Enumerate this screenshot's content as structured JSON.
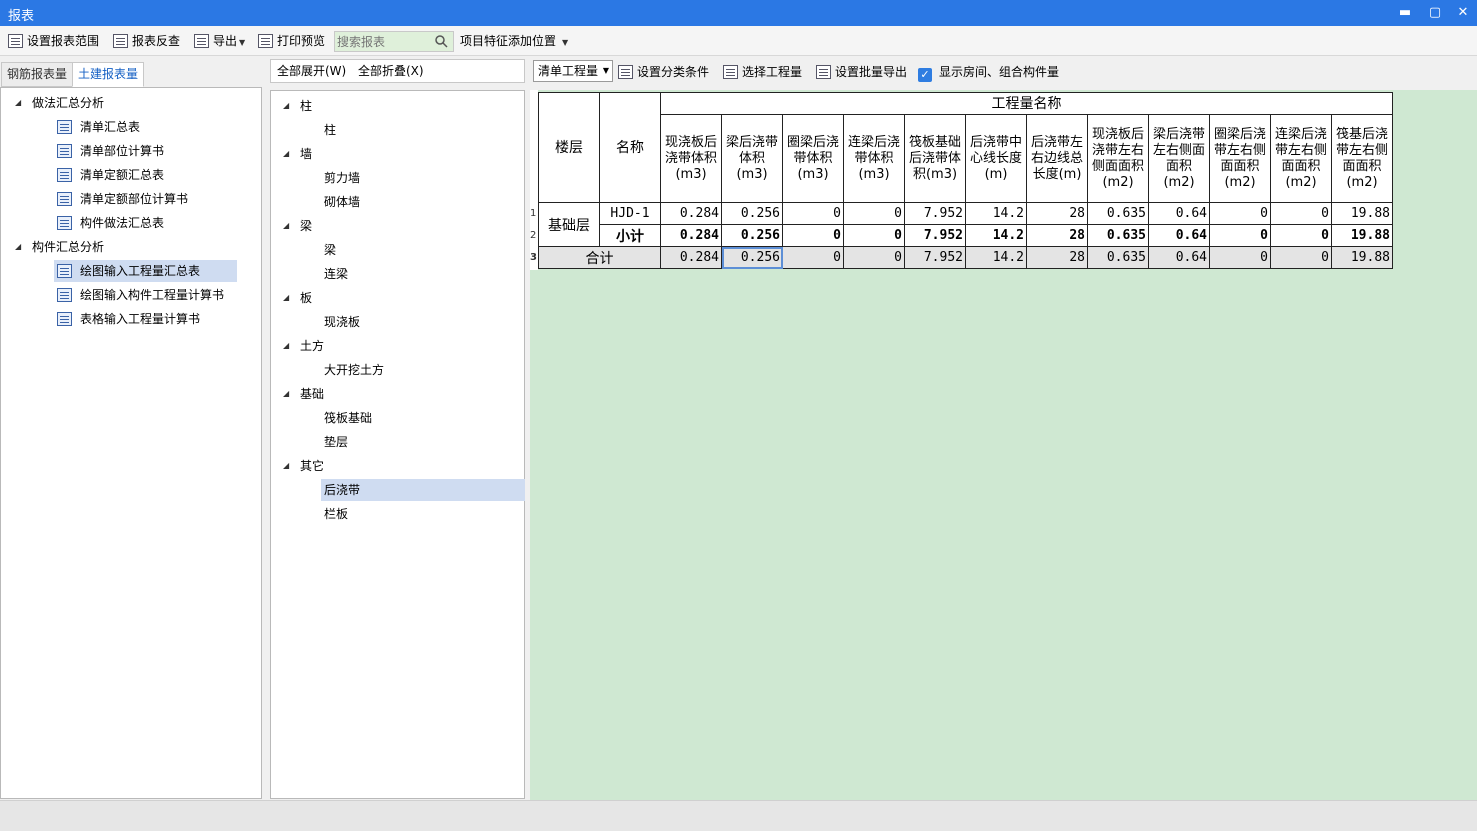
{
  "window": {
    "title": "报表",
    "min": "▬",
    "max": "▢",
    "close": "✕"
  },
  "toolbar": {
    "set_range": "设置报表范围",
    "reverse_check": "报表反查",
    "export": "导出",
    "print_preview": "打印预览",
    "search_placeholder": "搜索报表",
    "add_position": "项目特征添加位置"
  },
  "tabs": [
    "钢筋报表量",
    "土建报表量"
  ],
  "left_tree": {
    "group1": "做法汇总分析",
    "group1_items": [
      "清单汇总表",
      "清单部位计算书",
      "清单定额汇总表",
      "清单定额部位计算书",
      "构件做法汇总表"
    ],
    "group2": "构件汇总分析",
    "group2_items": [
      "绘图输入工程量汇总表",
      "绘图输入构件工程量计算书",
      "表格输入工程量计算书"
    ]
  },
  "mid": {
    "expand_all": "全部展开(W)",
    "collapse_all": "全部折叠(X)",
    "groups": [
      {
        "name": "柱",
        "items": [
          "柱"
        ]
      },
      {
        "name": "墙",
        "items": [
          "剪力墙",
          "砌体墙"
        ]
      },
      {
        "name": "梁",
        "items": [
          "梁",
          "连梁"
        ]
      },
      {
        "name": "板",
        "items": [
          "现浇板"
        ]
      },
      {
        "name": "土方",
        "items": [
          "大开挖土方"
        ]
      },
      {
        "name": "基础",
        "items": [
          "筏板基础",
          "垫层"
        ]
      },
      {
        "name": "其它",
        "items": [
          "后浇带",
          "栏板"
        ]
      }
    ]
  },
  "rtool": {
    "combo": "清单工程量",
    "set_classify": "设置分类条件",
    "select_qty": "选择工程量",
    "batch_export": "设置批量导出",
    "show_rooms": "显示房间、组合构件量"
  },
  "table": {
    "h_floor": "楼层",
    "h_name": "名称",
    "h_group": "工程量名称",
    "columns": [
      "现浇板后浇带体积(m3)",
      "梁后浇带体积(m3)",
      "圈梁后浇带体积(m3)",
      "连梁后浇带体积(m3)",
      "筏板基础后浇带体积(m3)",
      "后浇带中心线长度(m)",
      "后浇带左右边线总长度(m)",
      "现浇板后浇带左右侧面面积(m2)",
      "梁后浇带左右侧面面积(m2)",
      "圈梁后浇带左右侧面面积(m2)",
      "连梁后浇带左右侧面面积(m2)",
      "筏基后浇带左右侧面面积(m2)"
    ],
    "floor": "基础层",
    "row_numbers": [
      "1",
      "2",
      "3"
    ],
    "rows": [
      {
        "name": "HJD-1",
        "values": [
          "0.284",
          "0.256",
          "0",
          "0",
          "7.952",
          "14.2",
          "28",
          "0.635",
          "0.64",
          "0",
          "0",
          "19.88"
        ]
      },
      {
        "name": "小计",
        "values": [
          "0.284",
          "0.256",
          "0",
          "0",
          "7.952",
          "14.2",
          "28",
          "0.635",
          "0.64",
          "0",
          "0",
          "19.88"
        ]
      }
    ],
    "total_label": "合计",
    "total_values": [
      "0.284",
      "0.256",
      "0",
      "0",
      "7.952",
      "14.2",
      "28",
      "0.635",
      "0.64",
      "0",
      "0",
      "19.88"
    ]
  }
}
